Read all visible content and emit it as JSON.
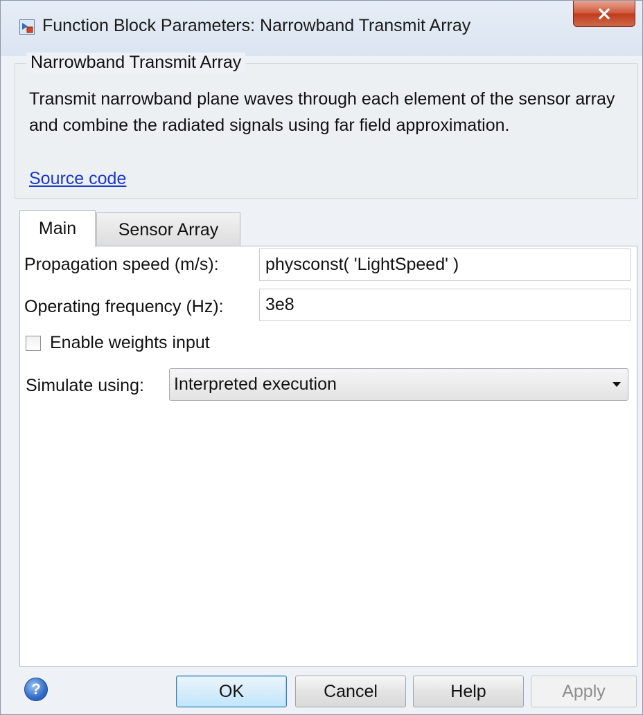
{
  "window": {
    "title": "Function Block Parameters: Narrowband Transmit Array",
    "close_label": "X"
  },
  "description": {
    "group_title": "Narrowband Transmit Array",
    "text": "Transmit narrowband plane waves through each element of the sensor array and combine the radiated signals using far field approximation.",
    "link": "Source code"
  },
  "tabs": [
    {
      "label": "Main",
      "active": true
    },
    {
      "label": "Sensor Array",
      "active": false
    }
  ],
  "main": {
    "propagation_speed": {
      "label": "Propagation speed (m/s):",
      "value": "physconst( 'LightSpeed' )"
    },
    "operating_frequency": {
      "label": "Operating frequency (Hz):",
      "value": "3e8"
    },
    "enable_weights": {
      "label": "Enable weights input",
      "checked": false
    },
    "simulate_using": {
      "label": "Simulate using:",
      "value": "Interpreted execution"
    }
  },
  "buttons": {
    "ok": "OK",
    "cancel": "Cancel",
    "help": "Help",
    "apply": "Apply",
    "help_icon": "?"
  },
  "colors": {
    "link": "#1a37cc",
    "close_button": "#c9452a",
    "disabled_text": "#8d8d8d"
  },
  "icons": {
    "app": "simulink-block-icon",
    "help": "question-circle-icon"
  }
}
